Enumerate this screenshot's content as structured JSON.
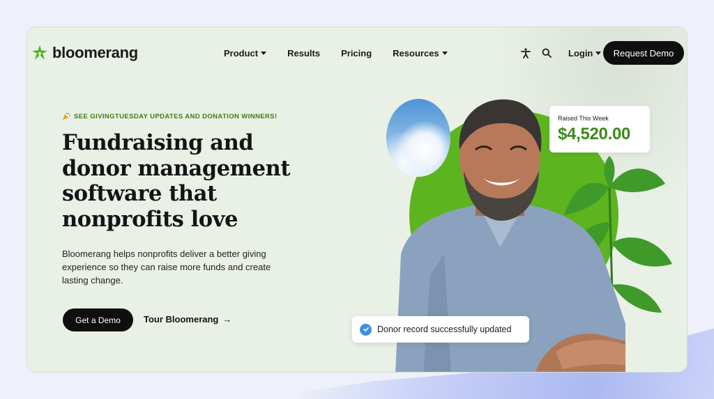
{
  "brand": {
    "name": "bloomerang",
    "color": "#4caf1a"
  },
  "nav": {
    "items": [
      {
        "label": "Product",
        "has_dropdown": true
      },
      {
        "label": "Results",
        "has_dropdown": false
      },
      {
        "label": "Pricing",
        "has_dropdown": false
      },
      {
        "label": "Resources",
        "has_dropdown": true
      }
    ],
    "icons": [
      "accessibility-icon",
      "search-icon"
    ],
    "login_label": "Login",
    "cta_label": "Request Demo"
  },
  "hero": {
    "eyebrow": "SEE GIVINGTUESDAY UPDATES AND DONATION WINNERS!",
    "headline_lines": [
      "Fundraising and",
      "donor management",
      "software that",
      "nonprofits love"
    ],
    "subtext": "Bloomerang helps nonprofits deliver a better giving experience so they can raise more funds and create lasting change.",
    "primary_cta": "Get a Demo",
    "secondary_cta": "Tour Bloomerang",
    "secondary_arrow": "→"
  },
  "cards": {
    "raised_label": "Raised This Week",
    "raised_amount": "$4,520.00",
    "toast_text": "Donor record successfully updated"
  },
  "colors": {
    "accent_green": "#5cb51f",
    "amount_green": "#3d8a1a",
    "check_blue": "#3f8fe0",
    "page_bg": "#e9f0e6"
  }
}
